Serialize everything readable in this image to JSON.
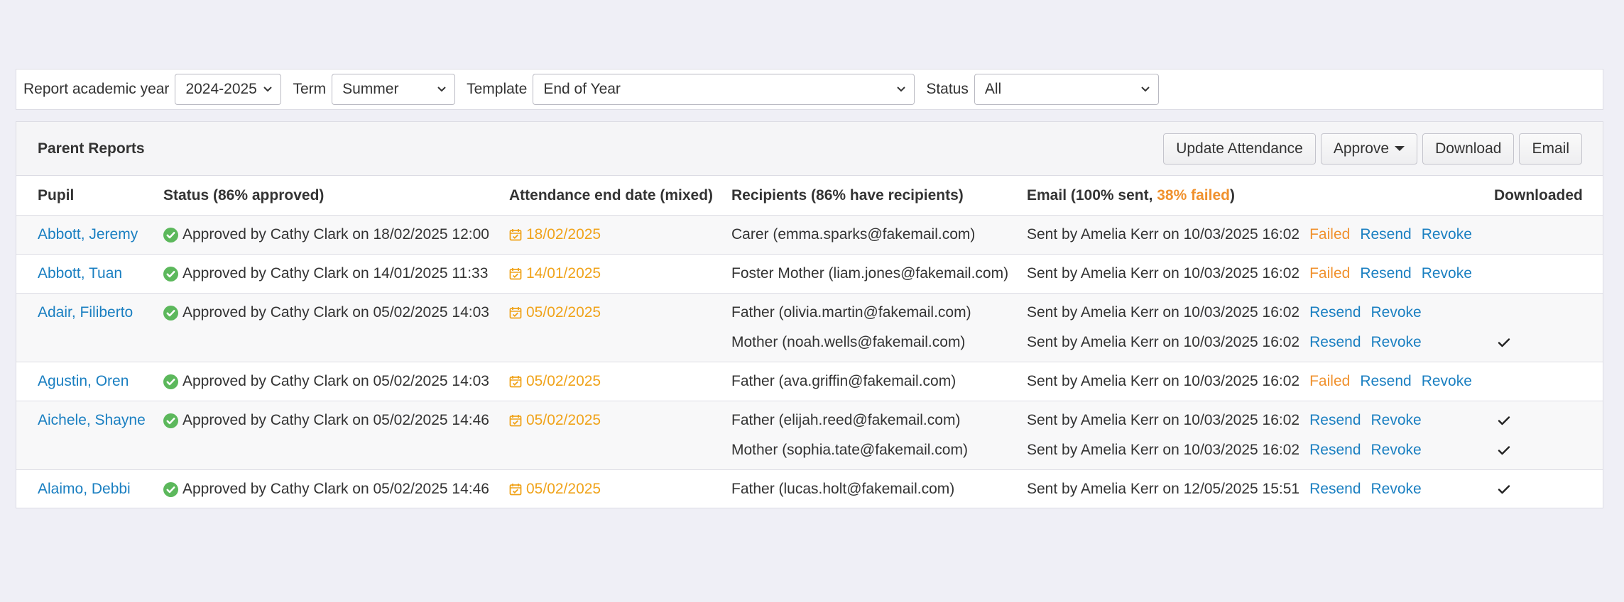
{
  "filters": {
    "year_label": "Report academic year",
    "year_value": "2024-2025",
    "term_label": "Term",
    "term_value": "Summer",
    "template_label": "Template",
    "template_value": "End of Year",
    "status_label": "Status",
    "status_value": "All"
  },
  "panel": {
    "title": "Parent Reports",
    "buttons": {
      "update_attendance": "Update Attendance",
      "approve": "Approve",
      "download": "Download",
      "email": "Email"
    }
  },
  "table": {
    "headers": {
      "pupil": "Pupil",
      "status": "Status (86% approved)",
      "attendance": "Attendance end date (mixed)",
      "recipients": "Recipients (86% have recipients)",
      "email_prefix": "Email (100% sent, ",
      "email_failed": "38% failed",
      "email_suffix": ")",
      "downloaded": "Downloaded"
    },
    "rows": [
      {
        "pupil": "Abbott, Jeremy",
        "status": "Approved by Cathy Clark on 18/02/2025 12:00",
        "date": "18/02/2025",
        "recipients": [
          {
            "recipient": "Carer (emma.sparks@fakemail.com)",
            "email": "Sent by Amelia Kerr on 10/03/2025 16:02",
            "failed": "Failed",
            "resend": "Resend",
            "revoke": "Revoke",
            "downloaded": false
          }
        ]
      },
      {
        "pupil": "Abbott, Tuan",
        "status": "Approved by Cathy Clark on 14/01/2025 11:33",
        "date": "14/01/2025",
        "recipients": [
          {
            "recipient": "Foster Mother (liam.jones@fakemail.com)",
            "email": "Sent by Amelia Kerr on 10/03/2025 16:02",
            "failed": "Failed",
            "resend": "Resend",
            "revoke": "Revoke",
            "downloaded": false
          }
        ]
      },
      {
        "pupil": "Adair, Filiberto",
        "status": "Approved by Cathy Clark on 05/02/2025 14:03",
        "date": "05/02/2025",
        "recipients": [
          {
            "recipient": "Father (olivia.martin@fakemail.com)",
            "email": "Sent by Amelia Kerr on 10/03/2025 16:02",
            "failed": "",
            "resend": "Resend",
            "revoke": "Revoke",
            "downloaded": false
          },
          {
            "recipient": "Mother (noah.wells@fakemail.com)",
            "email": "Sent by Amelia Kerr on 10/03/2025 16:02",
            "failed": "",
            "resend": "Resend",
            "revoke": "Revoke",
            "downloaded": true
          }
        ]
      },
      {
        "pupil": "Agustin, Oren",
        "status": "Approved by Cathy Clark on 05/02/2025 14:03",
        "date": "05/02/2025",
        "recipients": [
          {
            "recipient": "Father (ava.griffin@fakemail.com)",
            "email": "Sent by Amelia Kerr on 10/03/2025 16:02",
            "failed": "Failed",
            "resend": "Resend",
            "revoke": "Revoke",
            "downloaded": false
          }
        ]
      },
      {
        "pupil": "Aichele, Shayne",
        "status": "Approved by Cathy Clark on 05/02/2025 14:46",
        "date": "05/02/2025",
        "recipients": [
          {
            "recipient": "Father (elijah.reed@fakemail.com)",
            "email": "Sent by Amelia Kerr on 10/03/2025 16:02",
            "failed": "",
            "resend": "Resend",
            "revoke": "Revoke",
            "downloaded": true
          },
          {
            "recipient": "Mother (sophia.tate@fakemail.com)",
            "email": "Sent by Amelia Kerr on 10/03/2025 16:02",
            "failed": "",
            "resend": "Resend",
            "revoke": "Revoke",
            "downloaded": true
          }
        ]
      },
      {
        "pupil": "Alaimo, Debbi",
        "status": "Approved by Cathy Clark on 05/02/2025 14:46",
        "date": "05/02/2025",
        "recipients": [
          {
            "recipient": "Father (lucas.holt@fakemail.com)",
            "email": "Sent by Amelia Kerr on 12/05/2025 15:51",
            "failed": "",
            "resend": "Resend",
            "revoke": "Revoke",
            "downloaded": true
          }
        ]
      }
    ]
  },
  "colors": {
    "link": "#1a7fc1",
    "warning": "#f0912d",
    "date": "#f0a31a",
    "approved": "#5cb85c"
  },
  "icons": {
    "approved": "check-circle-icon",
    "date": "calendar-check-icon",
    "downloaded": "check-icon",
    "select": "chevron-down-icon",
    "approve_dropdown": "caret-down-icon"
  }
}
